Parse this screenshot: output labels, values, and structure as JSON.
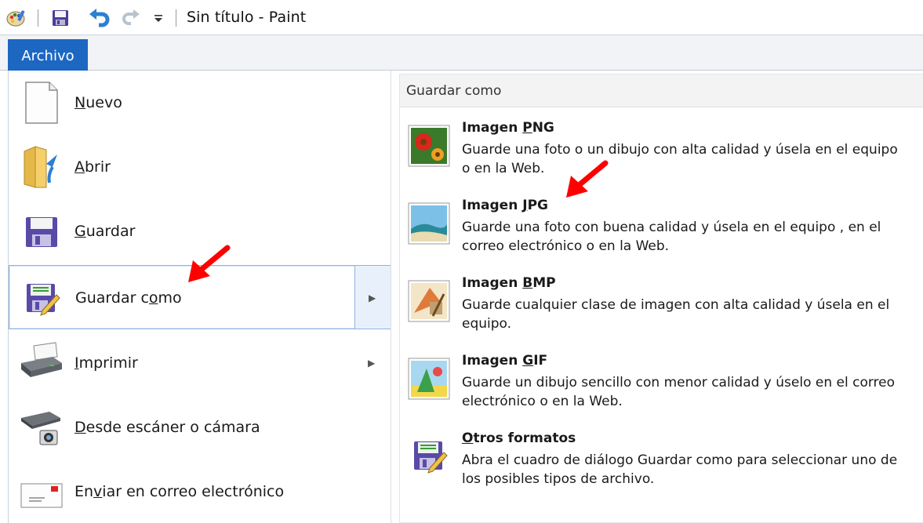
{
  "window": {
    "title": "Sin título - Paint",
    "qat": {
      "paint_icon": "paint-app-icon",
      "save_icon": "save-icon",
      "undo_icon": "undo-icon",
      "redo_icon": "redo-icon",
      "customize_icon": "customize-dropdown-icon"
    }
  },
  "ribbon": {
    "tab_archivo": "Archivo"
  },
  "menu": {
    "items": [
      {
        "key": "N",
        "rest": "uevo",
        "icon": "new-document-icon"
      },
      {
        "key": "A",
        "rest": "brir",
        "icon": "open-folder-icon"
      },
      {
        "key": "G",
        "rest": "uardar",
        "icon": "save-icon"
      },
      {
        "pre": "Guardar c",
        "key": "o",
        "rest": "mo",
        "icon": "save-as-icon",
        "has_submenu": true
      },
      {
        "pre": "",
        "key": "I",
        "rest": "mprimir",
        "icon": "printer-icon",
        "has_submenu": true
      },
      {
        "key": "D",
        "rest": "esde escáner o cámara",
        "icon": "scanner-camera-icon"
      },
      {
        "pre": "En",
        "key": "v",
        "rest": "iar en correo electrónico",
        "icon": "email-icon"
      }
    ]
  },
  "save_as_panel": {
    "heading": "Guardar como",
    "formats": [
      {
        "pre": "Imagen ",
        "key": "P",
        "rest": "NG",
        "desc": "Guarde una foto o un dibujo con alta calidad y úsela en el equipo o en la Web.",
        "icon": "png-image-icon"
      },
      {
        "pre": "Imagen ",
        "key": "J",
        "rest": "PG",
        "desc": "Guarde una foto con buena calidad y úsela en el equipo , en el correo electrónico o en la Web.",
        "icon": "jpg-image-icon"
      },
      {
        "pre": "Imagen ",
        "key": "B",
        "rest": "MP",
        "desc": "Guarde cualquier clase de imagen con alta calidad y úsela en el equipo.",
        "icon": "bmp-image-icon"
      },
      {
        "pre": "Imagen ",
        "key": "G",
        "rest": "IF",
        "desc": "Guarde un dibujo sencillo con menor calidad y úselo en el correo electrónico o en la Web.",
        "icon": "gif-image-icon"
      },
      {
        "pre": "",
        "key": "O",
        "rest": "tros formatos",
        "desc": "Abra el cuadro de diálogo Guardar como para seleccionar uno de los posibles tipos de archivo.",
        "icon": "other-formats-icon"
      }
    ]
  },
  "colors": {
    "accent": "#1c67c2",
    "annotation": "#ff0000"
  }
}
